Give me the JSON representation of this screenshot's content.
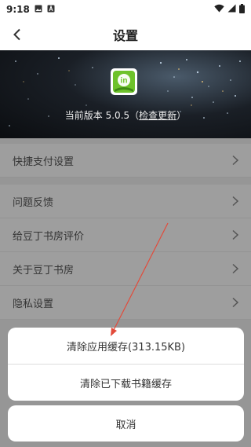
{
  "status_bar": {
    "time": "9:18"
  },
  "app_bar": {
    "title": "设置"
  },
  "banner": {
    "version_prefix": "当前版本 5.0.5（",
    "check_update": "检查更新",
    "version_suffix": "）",
    "logo_text": "in"
  },
  "settings": {
    "group1": [
      {
        "label": "快捷支付设置"
      }
    ],
    "group2": [
      {
        "label": "问题反馈"
      },
      {
        "label": "给豆丁书房评价"
      },
      {
        "label": "关于豆丁书房"
      },
      {
        "label": "隐私设置"
      }
    ]
  },
  "action_sheet": {
    "clear_app_cache": "清除应用缓存(313.15KB)",
    "clear_book_cache": "清除已下载书籍缓存",
    "cancel": "取消"
  },
  "colors": {
    "arrow": "#e24b3b",
    "logo_green": "#6ec22b"
  }
}
